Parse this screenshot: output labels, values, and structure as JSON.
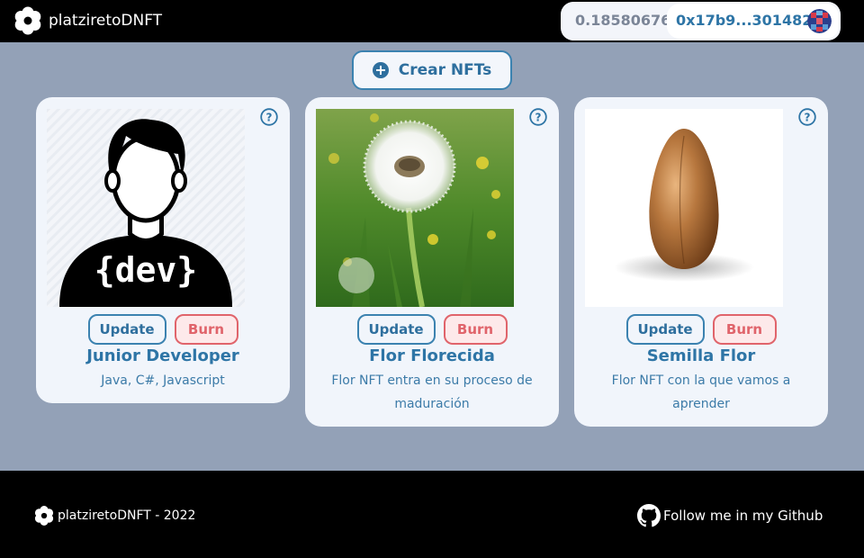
{
  "header": {
    "brand": "platziretoDNFT",
    "logo_icon": "flower-icon",
    "wallet": {
      "balance": "0.18580676",
      "address": "0x17b9...301482",
      "avatar_icon": "identicon-avatar"
    }
  },
  "actions": {
    "create_label": "Crear NFTs",
    "create_icon": "plus-circle-icon"
  },
  "cards": [
    {
      "title": "Junior Developer",
      "description": "Java, C#, Javascript",
      "image": "developer-avatar-image",
      "update_label": "Update",
      "burn_label": "Burn",
      "help_icon": "question-circle-icon"
    },
    {
      "title": "Flor Florecida",
      "description": "Flor NFT entra en su proceso de maduración",
      "image": "dandelion-flower-image",
      "update_label": "Update",
      "burn_label": "Burn",
      "help_icon": "question-circle-icon"
    },
    {
      "title": "Semilla Flor",
      "description": "Flor NFT con la que vamos a aprender",
      "image": "seed-image",
      "update_label": "Update",
      "burn_label": "Burn",
      "help_icon": "question-circle-icon"
    }
  ],
  "footer": {
    "brand_text": "platziretoDNFT - 2022",
    "github_text": "Follow me in my Github",
    "github_icon": "github-icon"
  },
  "colors": {
    "background": "#93a1b7",
    "bar": "#000000",
    "card": "#f1f5fb",
    "accent_blue": "#2e75a6",
    "burn_red": "#e0646b"
  }
}
